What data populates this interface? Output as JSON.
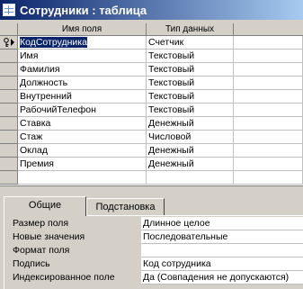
{
  "window": {
    "title": "Сотрудники : таблица"
  },
  "grid": {
    "headers": {
      "name": "Имя поля",
      "type": "Тип данных",
      "desc": ""
    },
    "rows": [
      {
        "name": "КодСотрудника",
        "type": "Счетчик"
      },
      {
        "name": "Имя",
        "type": "Текстовый"
      },
      {
        "name": "Фамилия",
        "type": "Текстовый"
      },
      {
        "name": "Должность",
        "type": "Текстовый"
      },
      {
        "name": "Внутренний",
        "type": "Текстовый"
      },
      {
        "name": "РабочийТелефон",
        "type": "Текстовый"
      },
      {
        "name": "Ставка",
        "type": "Денежный"
      },
      {
        "name": "Стаж",
        "type": "Числовой"
      },
      {
        "name": "Оклад",
        "type": "Денежный"
      },
      {
        "name": "Премия",
        "type": "Денежный"
      }
    ]
  },
  "tabs": {
    "general": "Общие",
    "lookup": "Подстановка"
  },
  "properties": [
    {
      "label": "Размер поля",
      "value": "Длинное целое"
    },
    {
      "label": "Новые значения",
      "value": "Последовательные"
    },
    {
      "label": "Формат поля",
      "value": ""
    },
    {
      "label": "Подпись",
      "value": "Код сотрудника"
    },
    {
      "label": "Индексированное поле",
      "value": "Да (Совпадения не допускаются)"
    }
  ],
  "colors": {
    "title_gradient_start": "#0a246a",
    "title_gradient_end": "#a6caf0",
    "selection": "#0a246a"
  }
}
